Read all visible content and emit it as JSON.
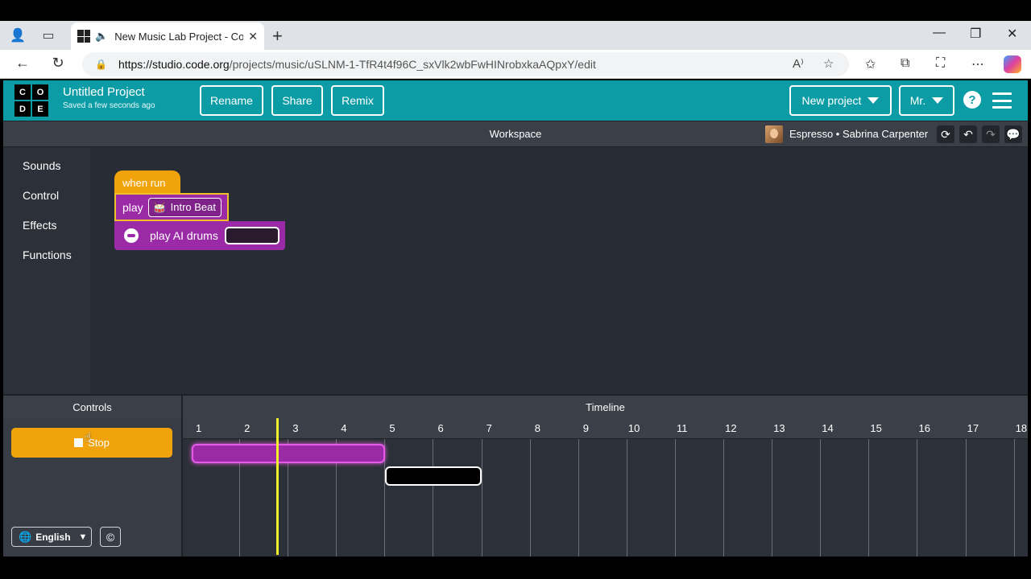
{
  "browser": {
    "tab_title": "New Music Lab Project - Code.org",
    "url_host": "https://studio.code.org",
    "url_path": "/projects/music/uSLNM-1-TfR4t4f96C_sxVlk2wbFwHINrobxkaAQpxY/edit"
  },
  "header": {
    "logo": [
      "C",
      "O",
      "D",
      "E"
    ],
    "project_title": "Untitled Project",
    "saved_status": "Saved a few seconds ago",
    "rename_label": "Rename",
    "share_label": "Share",
    "remix_label": "Remix",
    "new_project_label": "New project",
    "user_label": "Mr.",
    "help_label": "?"
  },
  "workspace_bar": {
    "title": "Workspace",
    "pack_name": "Espresso • Sabrina Carpenter"
  },
  "toolbox": {
    "categories": [
      "Sounds",
      "Control",
      "Effects",
      "Functions"
    ]
  },
  "blocks": {
    "hat_label": "when run",
    "play_label": "play",
    "sample_name": "Intro Beat",
    "ai_label": "play AI drums"
  },
  "controls": {
    "title": "Controls",
    "stop_label": "Stop",
    "language": "English"
  },
  "timeline": {
    "title": "Timeline",
    "measures": [
      "1",
      "2",
      "3",
      "4",
      "5",
      "6",
      "7",
      "8",
      "9",
      "10",
      "11",
      "12",
      "13",
      "14",
      "15",
      "16",
      "17",
      "18"
    ],
    "playhead_measure": 2.65
  },
  "colors": {
    "header_teal": "#0c9ca6",
    "hat_orange": "#f0a30b",
    "block_purple": "#9b2aa6",
    "playhead_yellow": "#f3f02a"
  }
}
